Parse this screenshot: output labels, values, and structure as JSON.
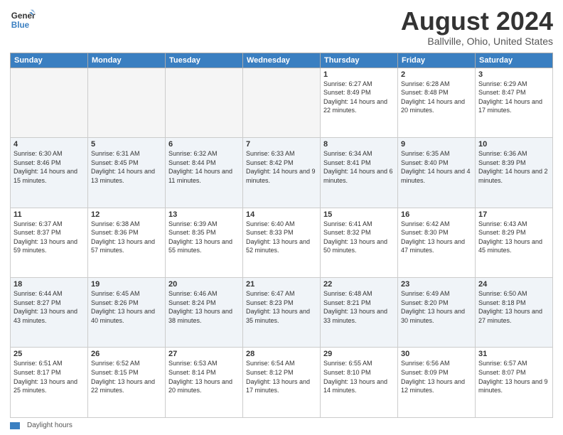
{
  "header": {
    "logo_text_line1": "General",
    "logo_text_line2": "Blue",
    "month": "August 2024",
    "location": "Ballville, Ohio, United States"
  },
  "days_of_week": [
    "Sunday",
    "Monday",
    "Tuesday",
    "Wednesday",
    "Thursday",
    "Friday",
    "Saturday"
  ],
  "weeks": [
    [
      {
        "day": "",
        "info": ""
      },
      {
        "day": "",
        "info": ""
      },
      {
        "day": "",
        "info": ""
      },
      {
        "day": "",
        "info": ""
      },
      {
        "day": "1",
        "info": "Sunrise: 6:27 AM\nSunset: 8:49 PM\nDaylight: 14 hours and 22 minutes."
      },
      {
        "day": "2",
        "info": "Sunrise: 6:28 AM\nSunset: 8:48 PM\nDaylight: 14 hours and 20 minutes."
      },
      {
        "day": "3",
        "info": "Sunrise: 6:29 AM\nSunset: 8:47 PM\nDaylight: 14 hours and 17 minutes."
      }
    ],
    [
      {
        "day": "4",
        "info": "Sunrise: 6:30 AM\nSunset: 8:46 PM\nDaylight: 14 hours and 15 minutes."
      },
      {
        "day": "5",
        "info": "Sunrise: 6:31 AM\nSunset: 8:45 PM\nDaylight: 14 hours and 13 minutes."
      },
      {
        "day": "6",
        "info": "Sunrise: 6:32 AM\nSunset: 8:44 PM\nDaylight: 14 hours and 11 minutes."
      },
      {
        "day": "7",
        "info": "Sunrise: 6:33 AM\nSunset: 8:42 PM\nDaylight: 14 hours and 9 minutes."
      },
      {
        "day": "8",
        "info": "Sunrise: 6:34 AM\nSunset: 8:41 PM\nDaylight: 14 hours and 6 minutes."
      },
      {
        "day": "9",
        "info": "Sunrise: 6:35 AM\nSunset: 8:40 PM\nDaylight: 14 hours and 4 minutes."
      },
      {
        "day": "10",
        "info": "Sunrise: 6:36 AM\nSunset: 8:39 PM\nDaylight: 14 hours and 2 minutes."
      }
    ],
    [
      {
        "day": "11",
        "info": "Sunrise: 6:37 AM\nSunset: 8:37 PM\nDaylight: 13 hours and 59 minutes."
      },
      {
        "day": "12",
        "info": "Sunrise: 6:38 AM\nSunset: 8:36 PM\nDaylight: 13 hours and 57 minutes."
      },
      {
        "day": "13",
        "info": "Sunrise: 6:39 AM\nSunset: 8:35 PM\nDaylight: 13 hours and 55 minutes."
      },
      {
        "day": "14",
        "info": "Sunrise: 6:40 AM\nSunset: 8:33 PM\nDaylight: 13 hours and 52 minutes."
      },
      {
        "day": "15",
        "info": "Sunrise: 6:41 AM\nSunset: 8:32 PM\nDaylight: 13 hours and 50 minutes."
      },
      {
        "day": "16",
        "info": "Sunrise: 6:42 AM\nSunset: 8:30 PM\nDaylight: 13 hours and 47 minutes."
      },
      {
        "day": "17",
        "info": "Sunrise: 6:43 AM\nSunset: 8:29 PM\nDaylight: 13 hours and 45 minutes."
      }
    ],
    [
      {
        "day": "18",
        "info": "Sunrise: 6:44 AM\nSunset: 8:27 PM\nDaylight: 13 hours and 43 minutes."
      },
      {
        "day": "19",
        "info": "Sunrise: 6:45 AM\nSunset: 8:26 PM\nDaylight: 13 hours and 40 minutes."
      },
      {
        "day": "20",
        "info": "Sunrise: 6:46 AM\nSunset: 8:24 PM\nDaylight: 13 hours and 38 minutes."
      },
      {
        "day": "21",
        "info": "Sunrise: 6:47 AM\nSunset: 8:23 PM\nDaylight: 13 hours and 35 minutes."
      },
      {
        "day": "22",
        "info": "Sunrise: 6:48 AM\nSunset: 8:21 PM\nDaylight: 13 hours and 33 minutes."
      },
      {
        "day": "23",
        "info": "Sunrise: 6:49 AM\nSunset: 8:20 PM\nDaylight: 13 hours and 30 minutes."
      },
      {
        "day": "24",
        "info": "Sunrise: 6:50 AM\nSunset: 8:18 PM\nDaylight: 13 hours and 27 minutes."
      }
    ],
    [
      {
        "day": "25",
        "info": "Sunrise: 6:51 AM\nSunset: 8:17 PM\nDaylight: 13 hours and 25 minutes."
      },
      {
        "day": "26",
        "info": "Sunrise: 6:52 AM\nSunset: 8:15 PM\nDaylight: 13 hours and 22 minutes."
      },
      {
        "day": "27",
        "info": "Sunrise: 6:53 AM\nSunset: 8:14 PM\nDaylight: 13 hours and 20 minutes."
      },
      {
        "day": "28",
        "info": "Sunrise: 6:54 AM\nSunset: 8:12 PM\nDaylight: 13 hours and 17 minutes."
      },
      {
        "day": "29",
        "info": "Sunrise: 6:55 AM\nSunset: 8:10 PM\nDaylight: 13 hours and 14 minutes."
      },
      {
        "day": "30",
        "info": "Sunrise: 6:56 AM\nSunset: 8:09 PM\nDaylight: 13 hours and 12 minutes."
      },
      {
        "day": "31",
        "info": "Sunrise: 6:57 AM\nSunset: 8:07 PM\nDaylight: 13 hours and 9 minutes."
      }
    ]
  ],
  "footer": {
    "legend_label": "Daylight hours"
  }
}
